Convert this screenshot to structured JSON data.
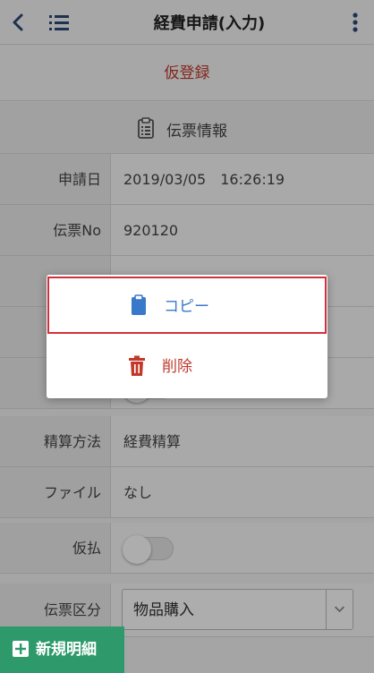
{
  "header": {
    "title": "経費申請(入力)"
  },
  "status_banner": "仮登録",
  "section": {
    "title": "伝票情報"
  },
  "rows": [
    {
      "label": "申請日",
      "value": "2019/03/05　16:26:19"
    },
    {
      "label": "伝票No",
      "value": "920120"
    },
    {
      "label": "精算方法",
      "value": "経費精算"
    },
    {
      "label": "ファイル",
      "value": "なし"
    },
    {
      "label": "仮払",
      "value": ""
    },
    {
      "label": "伝票区分",
      "value": "物品購入"
    }
  ],
  "advance_toggle_on": false,
  "popup": {
    "copy_label": "コピー",
    "delete_label": "削除"
  },
  "new_button": {
    "label": "新規明細"
  },
  "colors": {
    "accent_red": "#c0392b",
    "copy_blue": "#3a78c9",
    "new_button_green": "#2e9a6b",
    "header_icons": "#2c4a7a"
  }
}
